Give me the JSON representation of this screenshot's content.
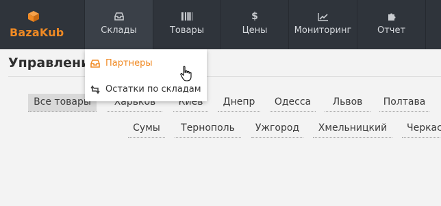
{
  "brand": {
    "name": "BazaKub",
    "icon": "cube-icon",
    "color": "#f08a24"
  },
  "nav": {
    "items": [
      {
        "label": "Склады",
        "icon": "warehouse-icon"
      },
      {
        "label": "Товары",
        "icon": "barcode-icon"
      },
      {
        "label": "Цены",
        "icon": "dollar-icon"
      },
      {
        "label": "Мониторинг",
        "icon": "chart-line-icon"
      },
      {
        "label": "Отчет",
        "icon": "puzzle-icon"
      }
    ]
  },
  "dropdown": {
    "items": [
      {
        "label": "Партнеры",
        "icon": "inbox-icon"
      },
      {
        "label": "Остатки по складам",
        "icon": "retweet-icon"
      }
    ]
  },
  "page": {
    "title": "Управлени"
  },
  "filters": {
    "row1": [
      "Все товары",
      "Харьков",
      "Киев",
      "Днепр",
      "Одесса",
      "Львов",
      "Полтава"
    ],
    "row2": [
      "Сумы",
      "Тернополь",
      "Ужгород",
      "Хмельницкий",
      "Черкас"
    ]
  },
  "colors": {
    "nav_bg": "#2f343b",
    "accent": "#f08a24",
    "chip_selected": "#d9d9d9"
  }
}
